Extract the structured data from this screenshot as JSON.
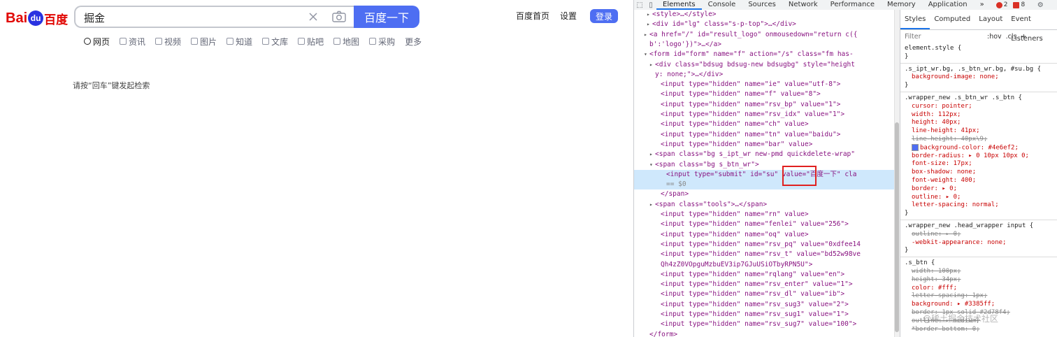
{
  "baidu": {
    "logo_text": "Bai",
    "logo_paw": "du",
    "logo_cn": "百度",
    "search_value": "掘金",
    "search_button": "百度一下",
    "links": [
      "百度首页",
      "设置"
    ],
    "login": "登录",
    "tabs": [
      {
        "label": "网页",
        "active": true
      },
      {
        "label": "资讯",
        "active": false
      },
      {
        "label": "视频",
        "active": false
      },
      {
        "label": "图片",
        "active": false
      },
      {
        "label": "知道",
        "active": false
      },
      {
        "label": "文库",
        "active": false
      },
      {
        "label": "贴吧",
        "active": false
      },
      {
        "label": "地图",
        "active": false
      },
      {
        "label": "采购",
        "active": false
      },
      {
        "label": "更多",
        "active": false
      }
    ],
    "hint": "请按“回车”键发起检索",
    "accent_color": "#4e6ef2"
  },
  "devtools": {
    "tabs": [
      "Elements",
      "Console",
      "Sources",
      "Network",
      "Performance",
      "Memory",
      "Application",
      "»"
    ],
    "active_tab": "Elements",
    "errors": "2",
    "warnings": "8",
    "elements_lines": [
      "<style>…</style>",
      "<div id=\"lg\" class=\"s-p-top\">…</div>",
      "<a href=\"/\" id=\"result_logo\" onmousedown=\"return c({",
      "b':'logo'})\">…</a>",
      "<form id=\"form\" name=\"f\" action=\"/s\" class=\"fm  has-",
      "<div class=\"bdsug bdsug-new bdsugbg\" style=\"height",
      "y: none;\">…</div>",
      "<input type=\"hidden\" name=\"ie\" value=\"utf-8\">",
      "<input type=\"hidden\" name=\"f\" value=\"8\">",
      "<input type=\"hidden\" name=\"rsv_bp\" value=\"1\">",
      "<input type=\"hidden\" name=\"rsv_idx\" value=\"1\">",
      "<input type=\"hidden\" name=\"ch\" value>",
      "<input type=\"hidden\" name=\"tn\" value=\"baidu\">",
      "<input type=\"hidden\" name=\"bar\" value>",
      "<span class=\"bg s_ipt_wr new-pmd quickdelete-wrap\"",
      "<span class=\"bg s_btn_wr\">",
      "<input type=\"submit\" id=\"su\" value=\"百度一下\" cla",
      "== $0",
      "</span>",
      "<span class=\"tools\">…</span>",
      "<input type=\"hidden\" name=\"rn\" value>",
      "<input type=\"hidden\" name=\"fenlei\" value=\"256\">",
      "<input type=\"hidden\" name=\"oq\" value>",
      "<input type=\"hidden\" name=\"rsv_pq\" value=\"0xdfee14",
      "<input type=\"hidden\" name=\"rsv_t\" value=\"bd52w98ve",
      "Qh4zZ0VOpguMzbuEV3ip7GJuUSiOTbyRPN5U\">",
      "<input type=\"hidden\" name=\"rqlang\" value=\"en\">",
      "<input type=\"hidden\" name=\"rsv_enter\" value=\"1\">",
      "<input type=\"hidden\" name=\"rsv_dl\" value=\"ib\">",
      "<input type=\"hidden\" name=\"rsv_sug3\" value=\"2\">",
      "<input type=\"hidden\" name=\"rsv_sug1\" value=\"1\">",
      "<input type=\"hidden\" name=\"rsv_sug7\" value=\"100\">",
      "</form>"
    ],
    "styles_tabs": [
      "Styles",
      "Computed",
      "Layout",
      "Event Listeners"
    ],
    "filter_placeholder": "Filter",
    "hov": ":hov",
    "cls": ".cls",
    "styles_lines": [
      "element.style {",
      "}",
      ".s_ipt_wr.bg, .s_btn_wr.bg, #su.bg {",
      "background-image: none;",
      "}",
      ".wrapper_new .s_btn_wr .s_btn {",
      "cursor: pointer;",
      "width: 112px;",
      "height: 40px;",
      "line-height: 41px;",
      "line-height: 40px\\9;",
      "background-color: #4e6ef2;",
      "border-radius: ▸ 0 10px 10px 0;",
      "font-size: 17px;",
      "box-shadow: none;",
      "font-weight: 400;",
      "border: ▸ 0;",
      "outline: ▸ 0;",
      "letter-spacing: normal;",
      "}",
      ".wrapper_new .head_wrapper input {",
      "outline: ▸ 0;",
      "-webkit-appearance: none;",
      "}",
      ".s_btn {",
      "width: 100px;",
      "height: 34px;",
      "color: #fff;",
      "letter-spacing: 1px;",
      "background: ▸ #3385ff;",
      "border: 1px solid #2d78f4;",
      "outline: ▸ medium;",
      "*border-bottom: 0;"
    ],
    "watermark": "@稀土掘金技术社区"
  }
}
